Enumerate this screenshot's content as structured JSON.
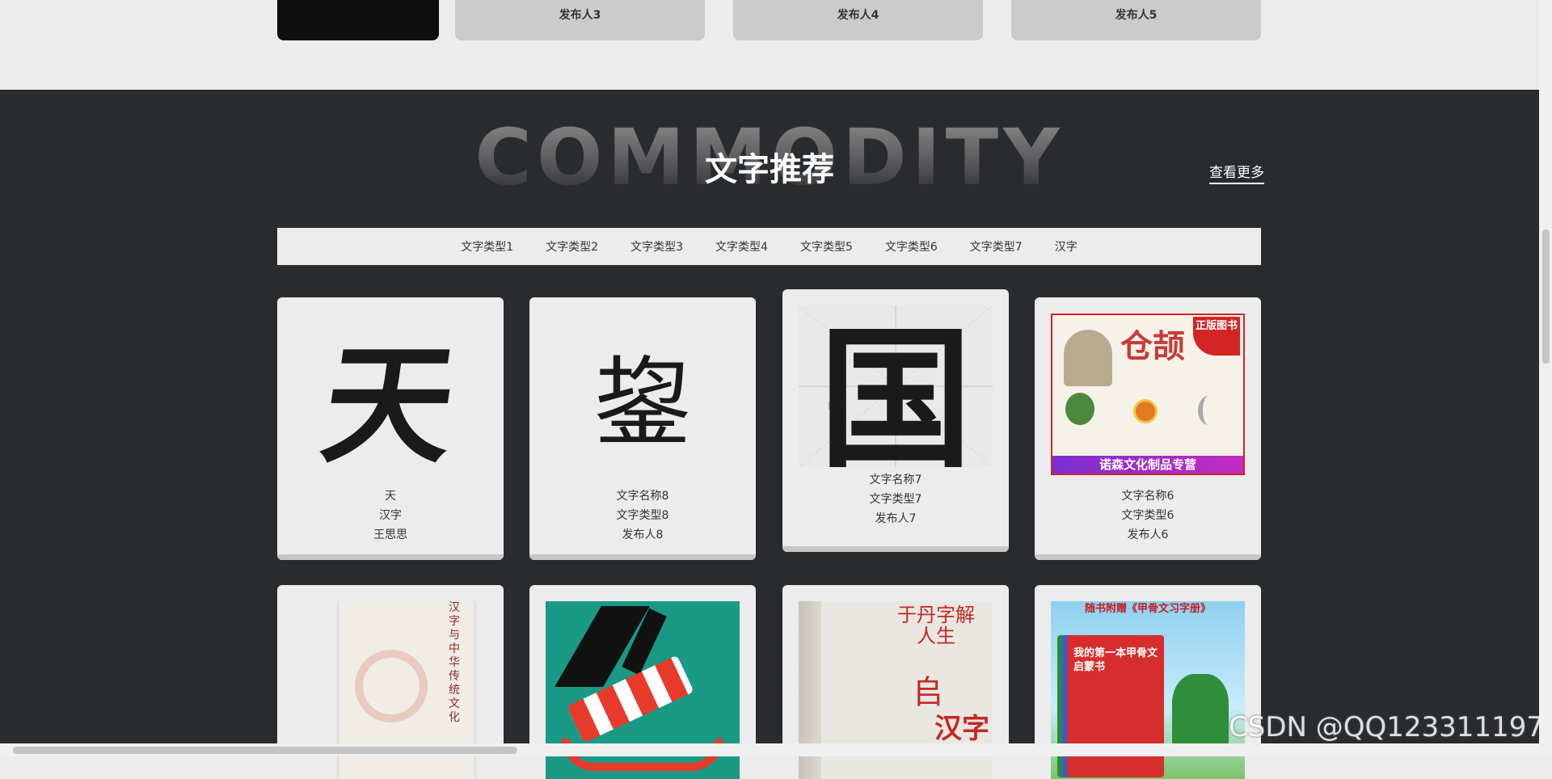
{
  "publishers_row": [
    "发布人3",
    "发布人4",
    "发布人5"
  ],
  "section": {
    "bg_word": "COMMODITY",
    "title": "文字推荐",
    "more": "查看更多"
  },
  "tabs": [
    "文字类型1",
    "文字类型2",
    "文字类型3",
    "文字类型4",
    "文字类型5",
    "文字类型6",
    "文字类型7",
    "汉字"
  ],
  "cards": [
    {
      "glyph": "天",
      "name": "天",
      "type": "汉字",
      "publisher": "王思思"
    },
    {
      "glyph": "鋆",
      "name": "文字名称8",
      "type": "文字类型8",
      "publisher": "发布人8"
    },
    {
      "glyph": "国",
      "name": "文字名称7",
      "type": "文字类型7",
      "publisher": "发布人7"
    },
    {
      "cover_title": "仓颉",
      "badge": "正版图书",
      "banner": "诺森文化制品专营",
      "name": "文字名称6",
      "type": "文字类型6",
      "publisher": "发布人6"
    }
  ],
  "row2": [
    {
      "cover_title": "汉字与中华传统文化"
    },
    {
      "cover_title": ""
    },
    {
      "cover_title": "于丹字解人生",
      "cover_sub": "汉字"
    },
    {
      "cover_title": "我的第一本甲骨文启蒙书",
      "banner": "随书附赠《甲骨文习字册》"
    }
  ],
  "watermark": "CSDN @QQ123311197",
  "colors": {
    "dark_bg": "#2a2b2f",
    "light_bg": "#ececec"
  }
}
